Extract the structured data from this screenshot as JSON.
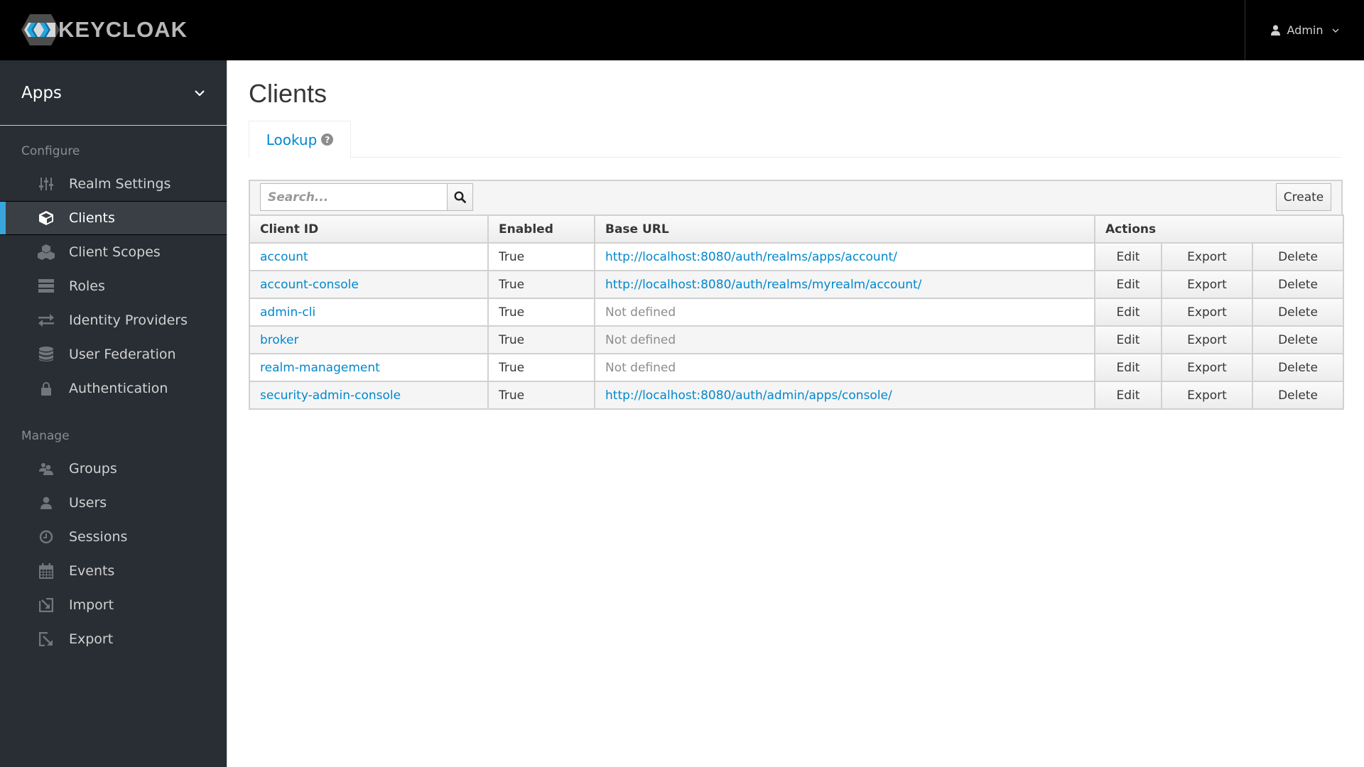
{
  "header": {
    "brand": "KEYCLOAK",
    "user_label": "Admin",
    "colors": {
      "bar": "#000000",
      "accent": "#39a5dc",
      "logo_blue": "#1fa7e0"
    }
  },
  "sidebar": {
    "realm": "Apps",
    "sections": [
      {
        "title": "Configure",
        "items": [
          {
            "label": "Realm Settings",
            "icon": "sliders-icon",
            "active": false
          },
          {
            "label": "Clients",
            "icon": "cube-icon",
            "active": true
          },
          {
            "label": "Client Scopes",
            "icon": "cubes-icon",
            "active": false
          },
          {
            "label": "Roles",
            "icon": "server-icon",
            "active": false
          },
          {
            "label": "Identity Providers",
            "icon": "exchange-icon",
            "active": false
          },
          {
            "label": "User Federation",
            "icon": "database-icon",
            "active": false
          },
          {
            "label": "Authentication",
            "icon": "lock-icon",
            "active": false
          }
        ]
      },
      {
        "title": "Manage",
        "items": [
          {
            "label": "Groups",
            "icon": "users-icon",
            "active": false
          },
          {
            "label": "Users",
            "icon": "user-icon",
            "active": false
          },
          {
            "label": "Sessions",
            "icon": "clock-icon",
            "active": false
          },
          {
            "label": "Events",
            "icon": "calendar-icon",
            "active": false
          },
          {
            "label": "Import",
            "icon": "import-icon",
            "active": false
          },
          {
            "label": "Export",
            "icon": "export-icon",
            "active": false
          }
        ]
      }
    ]
  },
  "main": {
    "title": "Clients",
    "tabs": [
      {
        "label": "Lookup",
        "active": true
      }
    ],
    "search": {
      "placeholder": "Search...",
      "value": ""
    },
    "create_label": "Create",
    "table": {
      "columns": [
        "Client ID",
        "Enabled",
        "Base URL",
        "Actions"
      ],
      "action_labels": [
        "Edit",
        "Export",
        "Delete"
      ],
      "rows": [
        {
          "client_id": "account",
          "enabled": "True",
          "base_url": "http://localhost:8080/auth/realms/apps/account/",
          "defined": true
        },
        {
          "client_id": "account-console",
          "enabled": "True",
          "base_url": "http://localhost:8080/auth/realms/myrealm/account/",
          "defined": true
        },
        {
          "client_id": "admin-cli",
          "enabled": "True",
          "base_url": "Not defined",
          "defined": false
        },
        {
          "client_id": "broker",
          "enabled": "True",
          "base_url": "Not defined",
          "defined": false
        },
        {
          "client_id": "realm-management",
          "enabled": "True",
          "base_url": "Not defined",
          "defined": false
        },
        {
          "client_id": "security-admin-console",
          "enabled": "True",
          "base_url": "http://localhost:8080/auth/admin/apps/console/",
          "defined": true
        }
      ]
    }
  }
}
